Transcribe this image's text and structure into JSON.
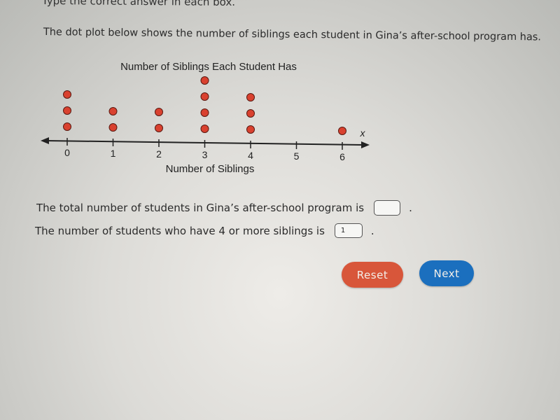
{
  "instructions": "Type the correct answer in each box.",
  "prompt": "The dot plot below shows the number of siblings each student in Gina’s after-school program has.",
  "chart_data": {
    "type": "scatter",
    "subtype": "dot_plot",
    "title": "Number of Siblings Each Student Has",
    "xlabel": "Number of Siblings",
    "axis_variable_label": "x",
    "x_ticks": [
      0,
      1,
      2,
      3,
      4,
      5,
      6
    ],
    "xlim": [
      0,
      6
    ],
    "axis_arrows": "both",
    "grid": false,
    "legend": "none",
    "dot_color": "#d9412f",
    "categories": [
      0,
      1,
      2,
      3,
      4,
      5,
      6
    ],
    "counts": [
      3,
      2,
      2,
      4,
      3,
      0,
      1
    ]
  },
  "questions": [
    {
      "text": "The total number of students in Gina’s after-school program is",
      "value": "",
      "suffix": "."
    },
    {
      "text": "The number of students who have 4 or more siblings is",
      "value": "1",
      "suffix": "."
    }
  ],
  "buttons": {
    "reset_label": "Reset",
    "next_label": "Next"
  }
}
